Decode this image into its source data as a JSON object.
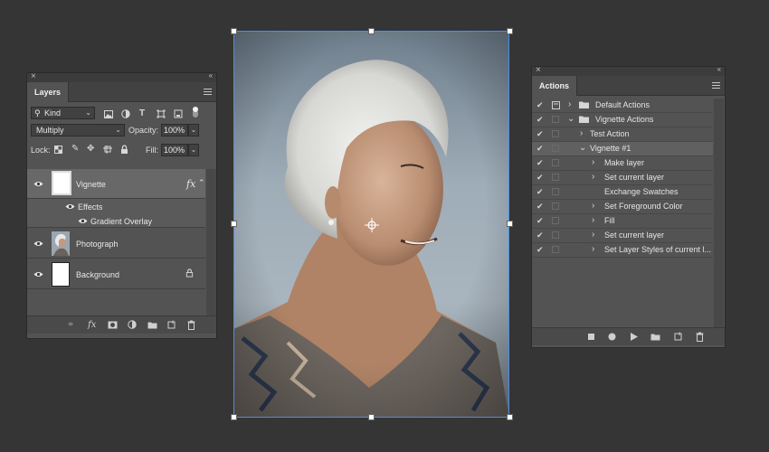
{
  "layers_panel": {
    "tab": "Layers",
    "filter_kind": "Kind",
    "blend_mode": "Multiply",
    "opacity_label": "Opacity:",
    "opacity_value": "100%",
    "lock_label": "Lock:",
    "fill_label": "Fill:",
    "fill_value": "100%",
    "layers": [
      {
        "name": "Vignette",
        "fx": "fx",
        "effects_label": "Effects",
        "effect": "Gradient Overlay"
      },
      {
        "name": "Photograph"
      },
      {
        "name": "Background"
      }
    ],
    "bottom_fx": "fx"
  },
  "actions_panel": {
    "tab": "Actions",
    "items": [
      {
        "label": "Default Actions"
      },
      {
        "label": "Vignette Actions"
      },
      {
        "label": "Test Action"
      },
      {
        "label": "Vignette #1"
      },
      {
        "label": "Make layer"
      },
      {
        "label": "Set current layer"
      },
      {
        "label": "Exchange Swatches"
      },
      {
        "label": "Set Foreground Color"
      },
      {
        "label": "Fill"
      },
      {
        "label": "Set current layer"
      },
      {
        "label": "Set Layer Styles of current l..."
      }
    ]
  },
  "colors": {
    "panel_bg": "#535353",
    "selection_border": "#4e8ee8",
    "app_bg": "#353535"
  }
}
